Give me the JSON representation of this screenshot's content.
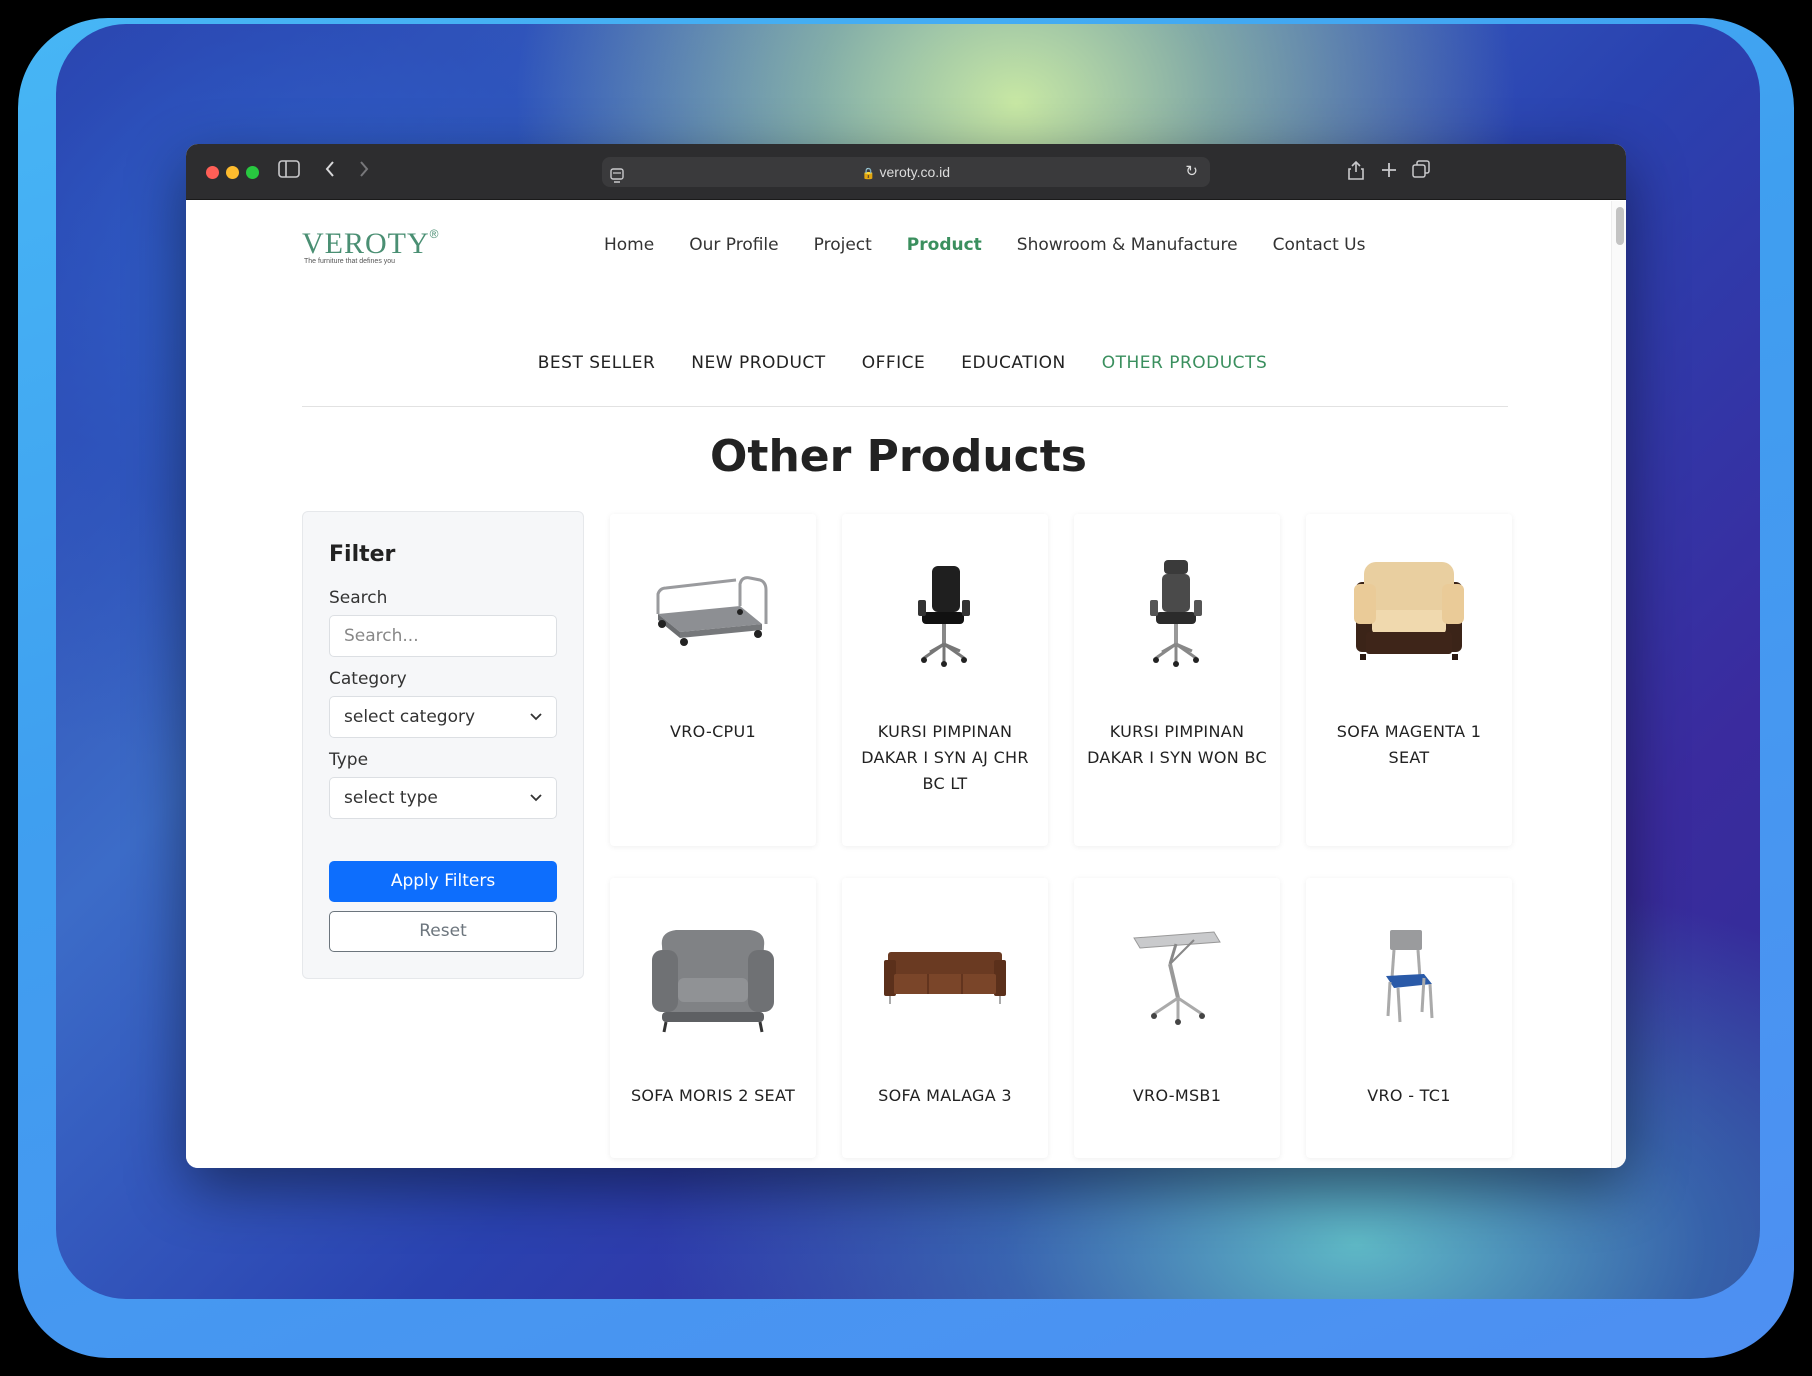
{
  "browser": {
    "url": "veroty.co.id"
  },
  "site": {
    "logo": "VEROTY",
    "logo_mark": "®",
    "tagline": "The furniture that defines you"
  },
  "nav": {
    "items": [
      {
        "label": "Home",
        "active": false
      },
      {
        "label": "Our Profile",
        "active": false
      },
      {
        "label": "Project",
        "active": false
      },
      {
        "label": "Product",
        "active": true
      },
      {
        "label": "Showroom & Manufacture",
        "active": false
      },
      {
        "label": "Contact Us",
        "active": false
      }
    ]
  },
  "category_tabs": {
    "items": [
      {
        "label": "BEST SELLER",
        "active": false
      },
      {
        "label": "NEW PRODUCT",
        "active": false
      },
      {
        "label": "OFFICE",
        "active": false
      },
      {
        "label": "EDUCATION",
        "active": false
      },
      {
        "label": "OTHER PRODUCTS",
        "active": true
      }
    ]
  },
  "page_title": "Other Products",
  "filter": {
    "title": "Filter",
    "search_label": "Search",
    "search_placeholder": "Search...",
    "category_label": "Category",
    "category_value": "select category",
    "type_label": "Type",
    "type_value": "select type",
    "apply_label": "Apply Filters",
    "reset_label": "Reset"
  },
  "products": [
    {
      "name": "VRO-CPU1",
      "icon": "trolley-icon"
    },
    {
      "name": "KURSI PIMPINAN DAKAR I SYN AJ CHR BC LT",
      "icon": "office-chair-icon"
    },
    {
      "name": "KURSI PIMPINAN DAKAR I SYN WON BC",
      "icon": "office-chair-icon"
    },
    {
      "name": "SOFA MAGENTA 1 SEAT",
      "icon": "armchair-icon"
    },
    {
      "name": "SOFA MORIS 2 SEAT",
      "icon": "armchair-icon"
    },
    {
      "name": "SOFA MALAGA 3",
      "icon": "sofa-icon"
    },
    {
      "name": "VRO-MSB1",
      "icon": "standing-table-icon"
    },
    {
      "name": "VRO - TC1",
      "icon": "chair-icon"
    }
  ],
  "colors": {
    "accent_green": "#3a8f5e",
    "primary_button": "#0d6efd"
  }
}
